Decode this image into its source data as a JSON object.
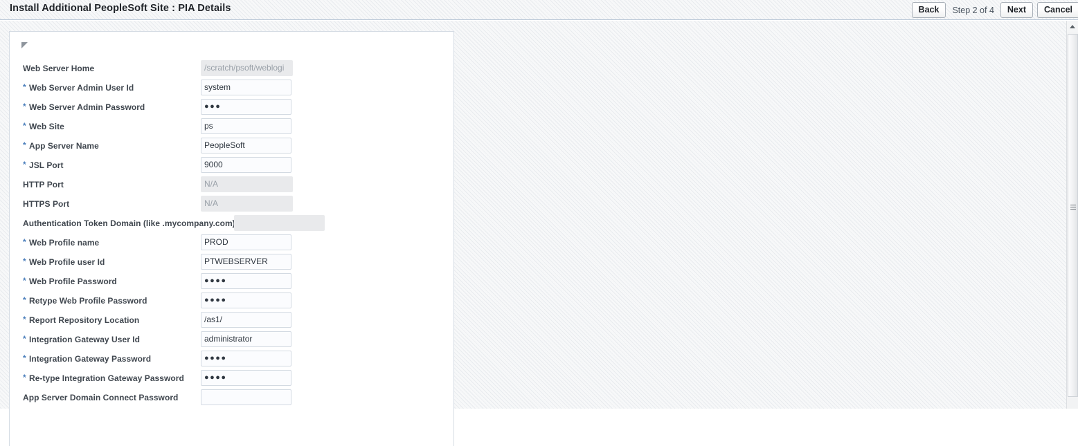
{
  "window": {
    "title": "Install Additional PeopleSoft Site : PIA Details"
  },
  "wizard": {
    "back_label": "Back",
    "step_indicator": "Step 2 of 4",
    "next_label": "Next",
    "cancel_label": "Cancel"
  },
  "panel": {
    "collapse_icon": "triangle-collapse-icon"
  },
  "form": {
    "required_marker": "*",
    "rows": [
      {
        "label": "Web Server Home",
        "required": false,
        "value": "/scratch/psoft/weblogi",
        "state": "disabled",
        "type": "text",
        "name": "web-server-home"
      },
      {
        "label": "Web Server Admin User Id",
        "required": true,
        "value": "system",
        "state": "enabled",
        "type": "text",
        "name": "web-server-admin-user-id"
      },
      {
        "label": "Web Server Admin Password",
        "required": true,
        "value": "●●●",
        "state": "enabled",
        "type": "password",
        "name": "web-server-admin-password"
      },
      {
        "label": "Web Site",
        "required": true,
        "value": "ps",
        "state": "enabled",
        "type": "text",
        "name": "web-site"
      },
      {
        "label": "App Server Name",
        "required": true,
        "value": "PeopleSoft",
        "state": "enabled",
        "type": "text",
        "name": "app-server-name"
      },
      {
        "label": "JSL Port",
        "required": true,
        "value": "9000",
        "state": "enabled",
        "type": "text",
        "name": "jsl-port"
      },
      {
        "label": "HTTP Port",
        "required": false,
        "value": "N/A",
        "state": "disabled",
        "type": "text",
        "name": "http-port"
      },
      {
        "label": "HTTPS Port",
        "required": false,
        "value": "N/A",
        "state": "disabled",
        "type": "text",
        "name": "https-port"
      },
      {
        "label": "Authentication Token Domain (like .mycompany.com)",
        "required": false,
        "value": "",
        "state": "disabled-offset",
        "type": "text",
        "name": "authentication-token-domain"
      },
      {
        "label": "Web Profile name",
        "required": true,
        "value": "PROD",
        "state": "enabled",
        "type": "text",
        "name": "web-profile-name"
      },
      {
        "label": "Web Profile user Id",
        "required": true,
        "value": "PTWEBSERVER",
        "state": "enabled",
        "type": "text",
        "name": "web-profile-user-id"
      },
      {
        "label": "Web Profile Password",
        "required": true,
        "value": "●●●●",
        "state": "enabled",
        "type": "password",
        "name": "web-profile-password"
      },
      {
        "label": "Retype Web Profile Password",
        "required": true,
        "value": "●●●●",
        "state": "enabled",
        "type": "password",
        "name": "retype-web-profile-password"
      },
      {
        "label": "Report Repository Location",
        "required": true,
        "value": "/as1/",
        "state": "enabled",
        "type": "text",
        "name": "report-repository-location"
      },
      {
        "label": "Integration Gateway User Id",
        "required": true,
        "value": "administrator",
        "state": "enabled",
        "type": "text",
        "name": "integration-gateway-user-id"
      },
      {
        "label": "Integration Gateway Password",
        "required": true,
        "value": "●●●●",
        "state": "enabled",
        "type": "password",
        "name": "integration-gateway-password"
      },
      {
        "label": "Re-type Integration Gateway Password",
        "required": true,
        "value": "●●●●",
        "state": "enabled",
        "type": "password",
        "name": "retype-integration-gateway-password"
      },
      {
        "label": "App Server Domain Connect Password",
        "required": false,
        "value": "",
        "state": "enabled",
        "type": "password",
        "name": "app-server-domain-connect-password"
      }
    ]
  },
  "scrollbar": {
    "up_arrow_icon": "chevron-up-icon",
    "thumb_grip_icon": "grip-lines-icon"
  },
  "colors": {
    "accent": "#4a7ebb",
    "label": "#40474f",
    "title": "#1f2328",
    "field_border": "#d3dae2",
    "disabled_bg": "#e9eaec"
  }
}
